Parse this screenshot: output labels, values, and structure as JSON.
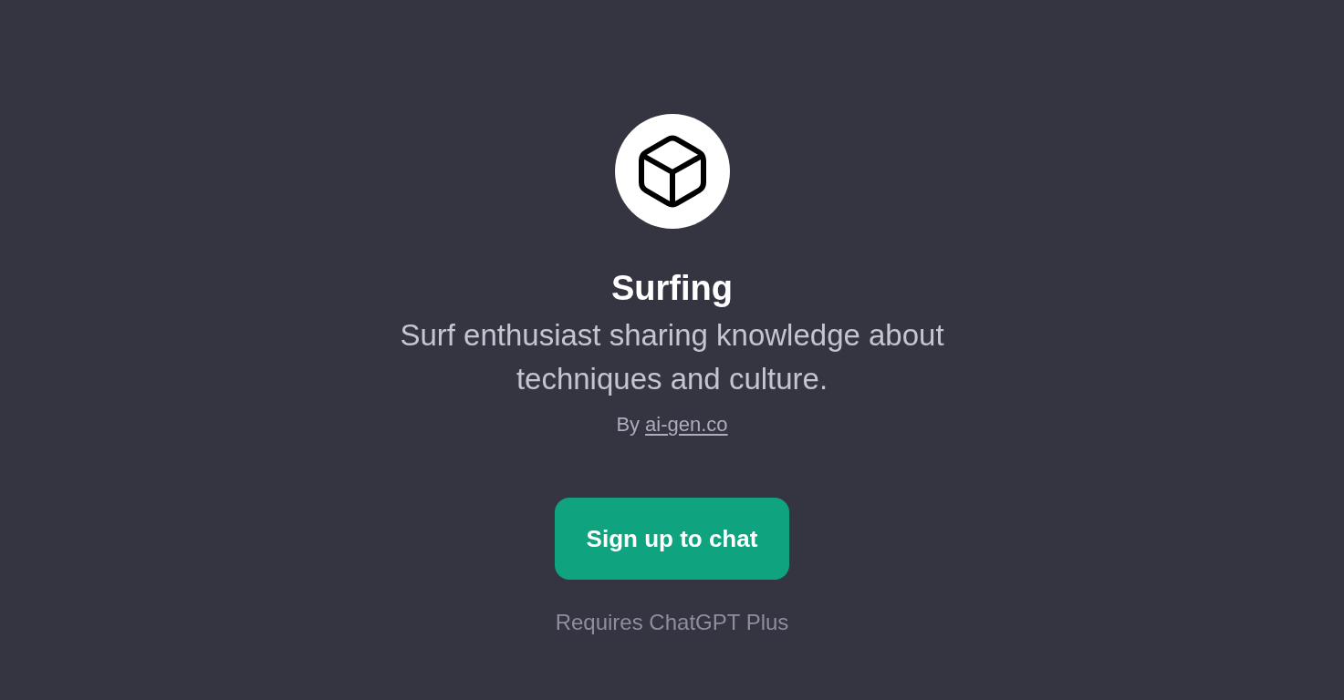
{
  "gpt": {
    "name": "Surfing",
    "description": "Surf enthusiast sharing knowledge about techniques and culture.",
    "byline": {
      "prefix": "By",
      "author": "ai-gen.co"
    }
  },
  "action": {
    "label": "Sign up to chat"
  },
  "note": "Requires ChatGPT Plus"
}
